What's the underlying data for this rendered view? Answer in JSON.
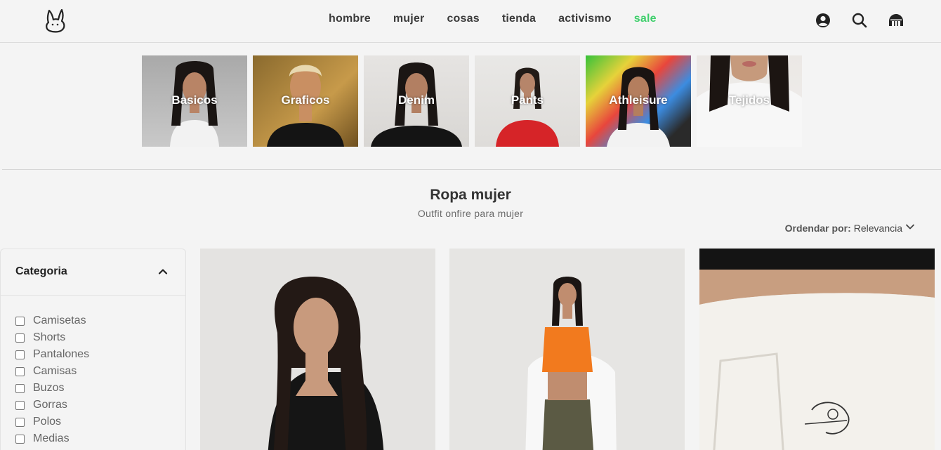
{
  "nav": {
    "items": [
      {
        "label": "hombre",
        "sale": false
      },
      {
        "label": "mujer",
        "sale": false
      },
      {
        "label": "cosas",
        "sale": false
      },
      {
        "label": "tienda",
        "sale": false
      },
      {
        "label": "activismo",
        "sale": false
      },
      {
        "label": "sale",
        "sale": true
      }
    ]
  },
  "header_icons": [
    "user-icon",
    "search-icon",
    "cart-icon"
  ],
  "categories": [
    {
      "label": "Basicos"
    },
    {
      "label": "Graficos"
    },
    {
      "label": "Denim"
    },
    {
      "label": "Pants"
    },
    {
      "label": "Athleisure"
    },
    {
      "label": "Tejidos"
    }
  ],
  "page": {
    "title": "Ropa mujer",
    "subtitle": "Outfit onfire para mujer"
  },
  "sort": {
    "label": "Ordendar por:",
    "value": "Relevancia"
  },
  "filters": {
    "title": "Categoria",
    "options": [
      "Camisetas",
      "Shorts",
      "Pantalones",
      "Camisas",
      "Buzos",
      "Gorras",
      "Polos",
      "Medias"
    ]
  },
  "colors": {
    "sale": "#3ecf6b",
    "background": "#f4f4f4"
  }
}
